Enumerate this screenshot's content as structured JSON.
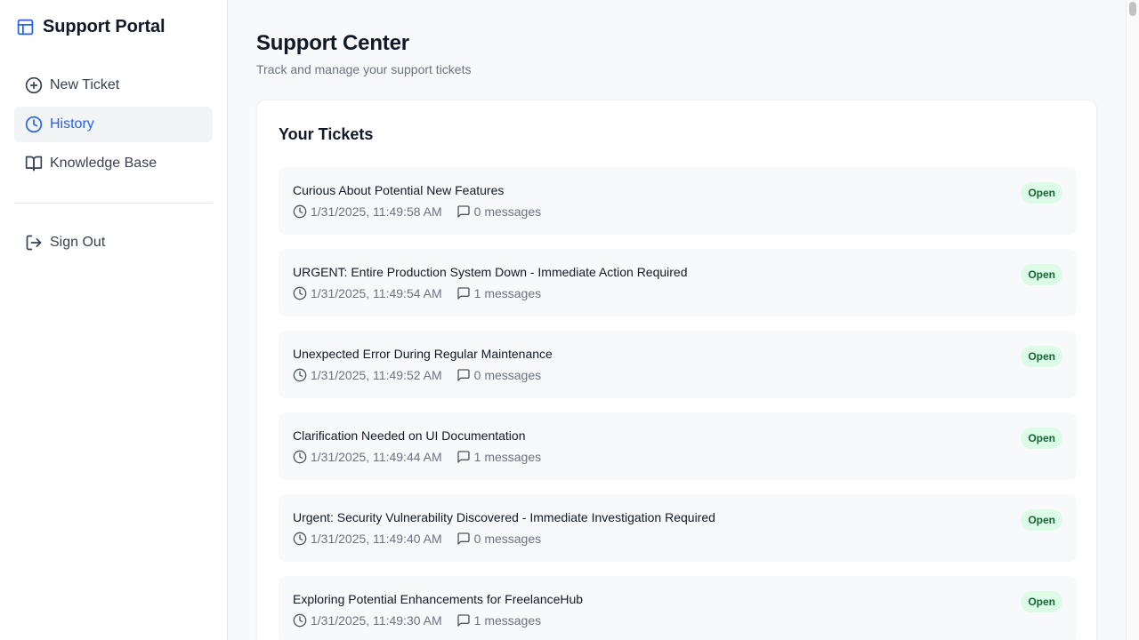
{
  "sidebar": {
    "brand": {
      "title": "Support Portal",
      "icon": "layout-panel-icon"
    },
    "nav": [
      {
        "label": "New Ticket",
        "icon": "plus-circle-icon",
        "active": false
      },
      {
        "label": "History",
        "icon": "clock-icon",
        "active": true
      },
      {
        "label": "Knowledge Base",
        "icon": "book-open-icon",
        "active": false
      }
    ],
    "signout": {
      "label": "Sign Out",
      "icon": "log-out-icon"
    }
  },
  "header": {
    "title": "Support Center",
    "subtitle": "Track and manage your support tickets"
  },
  "tickets": {
    "title": "Your Tickets",
    "items": [
      {
        "title": "Curious About Potential New Features",
        "date": "1/31/2025, 11:49:58 AM",
        "messages": "0 messages",
        "status": "Open"
      },
      {
        "title": "URGENT: Entire Production System Down - Immediate Action Required",
        "date": "1/31/2025, 11:49:54 AM",
        "messages": "1 messages",
        "status": "Open"
      },
      {
        "title": "Unexpected Error During Regular Maintenance",
        "date": "1/31/2025, 11:49:52 AM",
        "messages": "0 messages",
        "status": "Open"
      },
      {
        "title": "Clarification Needed on UI Documentation",
        "date": "1/31/2025, 11:49:44 AM",
        "messages": "1 messages",
        "status": "Open"
      },
      {
        "title": "Urgent: Security Vulnerability Discovered - Immediate Investigation Required",
        "date": "1/31/2025, 11:49:40 AM",
        "messages": "0 messages",
        "status": "Open"
      },
      {
        "title": "Exploring Potential Enhancements for FreelanceHub",
        "date": "1/31/2025, 11:49:30 AM",
        "messages": "1 messages",
        "status": "Open"
      }
    ]
  },
  "colors": {
    "accent": "#2563eb",
    "status_open_bg": "#dcfce7",
    "status_open_text": "#166534",
    "sidebar_active_bg": "#f3f4f6"
  }
}
